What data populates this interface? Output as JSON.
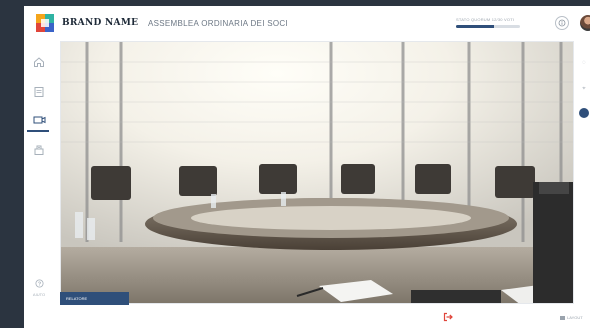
{
  "header": {
    "brand": "BRAND NAME",
    "meeting_title": "ASSEMBLEA ORDINARIA DEI SOCI",
    "progress_label": "STATO QUORUM 12/30 VOTI",
    "progress_fraction": 0.6,
    "info_icon": "info-icon",
    "avatar_icon": "user-avatar"
  },
  "leftrail": {
    "items": [
      {
        "name": "home-icon"
      },
      {
        "name": "document-icon"
      },
      {
        "name": "video-icon",
        "active": true
      },
      {
        "name": "vote-icon"
      }
    ],
    "bottom_label": "AIUTO",
    "settings_icon": "settings-icon"
  },
  "rightrail": {
    "items": [
      {
        "name": "chat-icon",
        "glyph": "◌"
      },
      {
        "name": "people-icon",
        "glyph": "⌖"
      },
      {
        "name": "notification-icon",
        "glyph": "●"
      }
    ]
  },
  "stage": {
    "caption": "RELATORE"
  },
  "footer": {
    "exit_icon": "exit-icon",
    "right_label": "LAYOUT"
  },
  "colors": {
    "accent": "#2f4f7a",
    "exit": "#e0453a",
    "background": "#2b3440"
  }
}
